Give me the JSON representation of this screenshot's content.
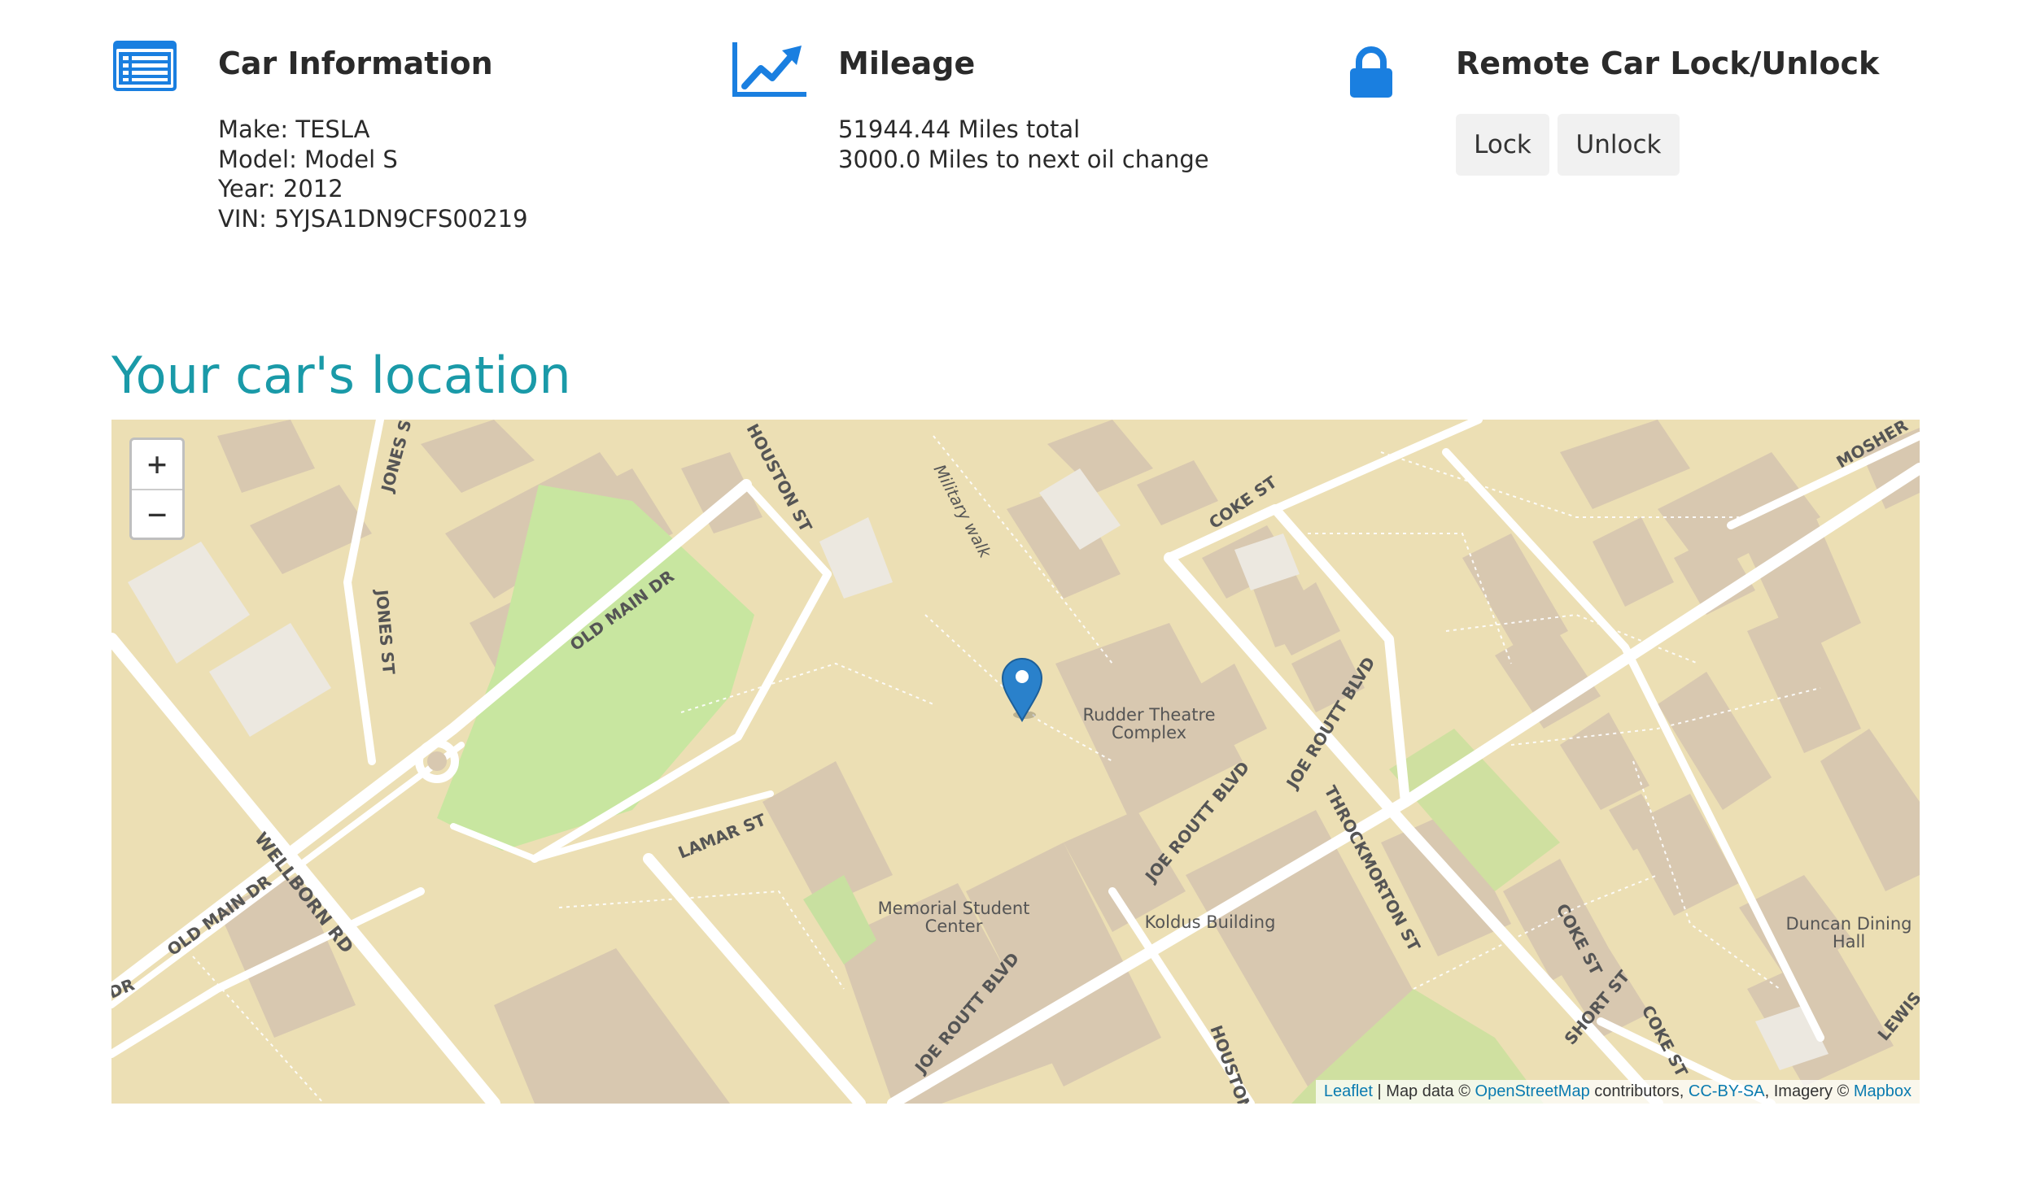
{
  "car_info": {
    "title": "Car Information",
    "make": "Make: TESLA",
    "model": "Model: Model S",
    "year": "Year: 2012",
    "vin": "VIN: 5YJSA1DN9CFS00219",
    "icon": "list-icon"
  },
  "mileage": {
    "title": "Mileage",
    "total": "51944.44 Miles total",
    "oil": "3000.0 Miles to next oil change",
    "icon": "chart-line-icon"
  },
  "remote_lock": {
    "title": "Remote Car Lock/Unlock",
    "lock_label": "Lock",
    "unlock_label": "Unlock",
    "icon": "lock-icon"
  },
  "location": {
    "title": "Your car's location"
  },
  "map": {
    "zoom_in": "+",
    "zoom_out": "−",
    "streets": {
      "houston_st": "HOUSTON ST",
      "jones_st": "JONES ST",
      "military_walk": "Military walk",
      "coke_st": "COKE ST",
      "moshe": "MOSHER",
      "old_main_dr": "OLD MAIN DR",
      "lamar_st": "LAMAR ST",
      "wellborn_rd": "WELLBORN RD",
      "joe_routt_blvd": "JOE ROUTT BLVD",
      "throckmorton_st": "THROCKMORTON ST",
      "short_st": "SHORT ST",
      "lewis": "LEWIS",
      "dr": "DR"
    },
    "places": {
      "rudder_1": "Rudder Theatre",
      "rudder_2": "Complex",
      "msc_1": "Memorial Student",
      "msc_2": "Center",
      "koldus": "Koldus Building",
      "duncan_1": "Duncan Dining",
      "duncan_2": "Hall"
    },
    "attribution": {
      "leaflet": "Leaflet",
      "sep1": " | Map data © ",
      "osm": "OpenStreetMap",
      "sep2": " contributors, ",
      "cc": "CC-BY-SA",
      "sep3": ", Imagery © ",
      "mapbox": "Mapbox"
    },
    "colors": {
      "land": "#ecdfb4",
      "building": "#d8c8b0",
      "park": "#c8e6a0",
      "road": "#ffffff",
      "marker": "#2a81cb"
    }
  },
  "colors": {
    "accent": "#1a9aa8",
    "icon_blue": "#1a7fe0"
  }
}
